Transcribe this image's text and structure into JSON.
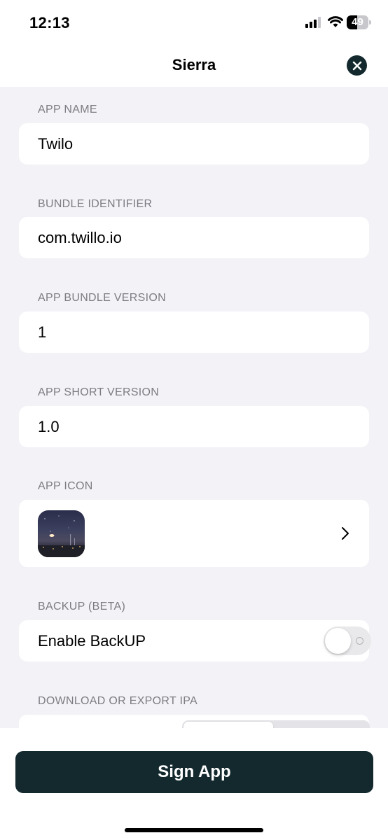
{
  "status_bar": {
    "time": "12:13",
    "battery_percent": 49,
    "battery_label": "49"
  },
  "header": {
    "title": "Sierra"
  },
  "fields": {
    "app_name_label": "APP NAME",
    "app_name_value": "Twilo",
    "bundle_id_label": "BUNDLE IDENTIFIER",
    "bundle_id_value": "com.twillo.io",
    "bundle_version_label": "APP BUNDLE VERSION",
    "bundle_version_value": "1",
    "short_version_label": "APP SHORT VERSION",
    "short_version_value": "1.0",
    "app_icon_label": "APP ICON"
  },
  "backup": {
    "section_label": "BACKUP (BETA)",
    "toggle_label": "Enable BackUP",
    "enabled": false
  },
  "download": {
    "section_label": "DOWNLOAD OR EXPORT IPA"
  },
  "footer": {
    "sign_button_label": "Sign App"
  },
  "colors": {
    "accent": "#13292e",
    "background": "#f2f2f7",
    "label_gray": "#7c7c82"
  }
}
